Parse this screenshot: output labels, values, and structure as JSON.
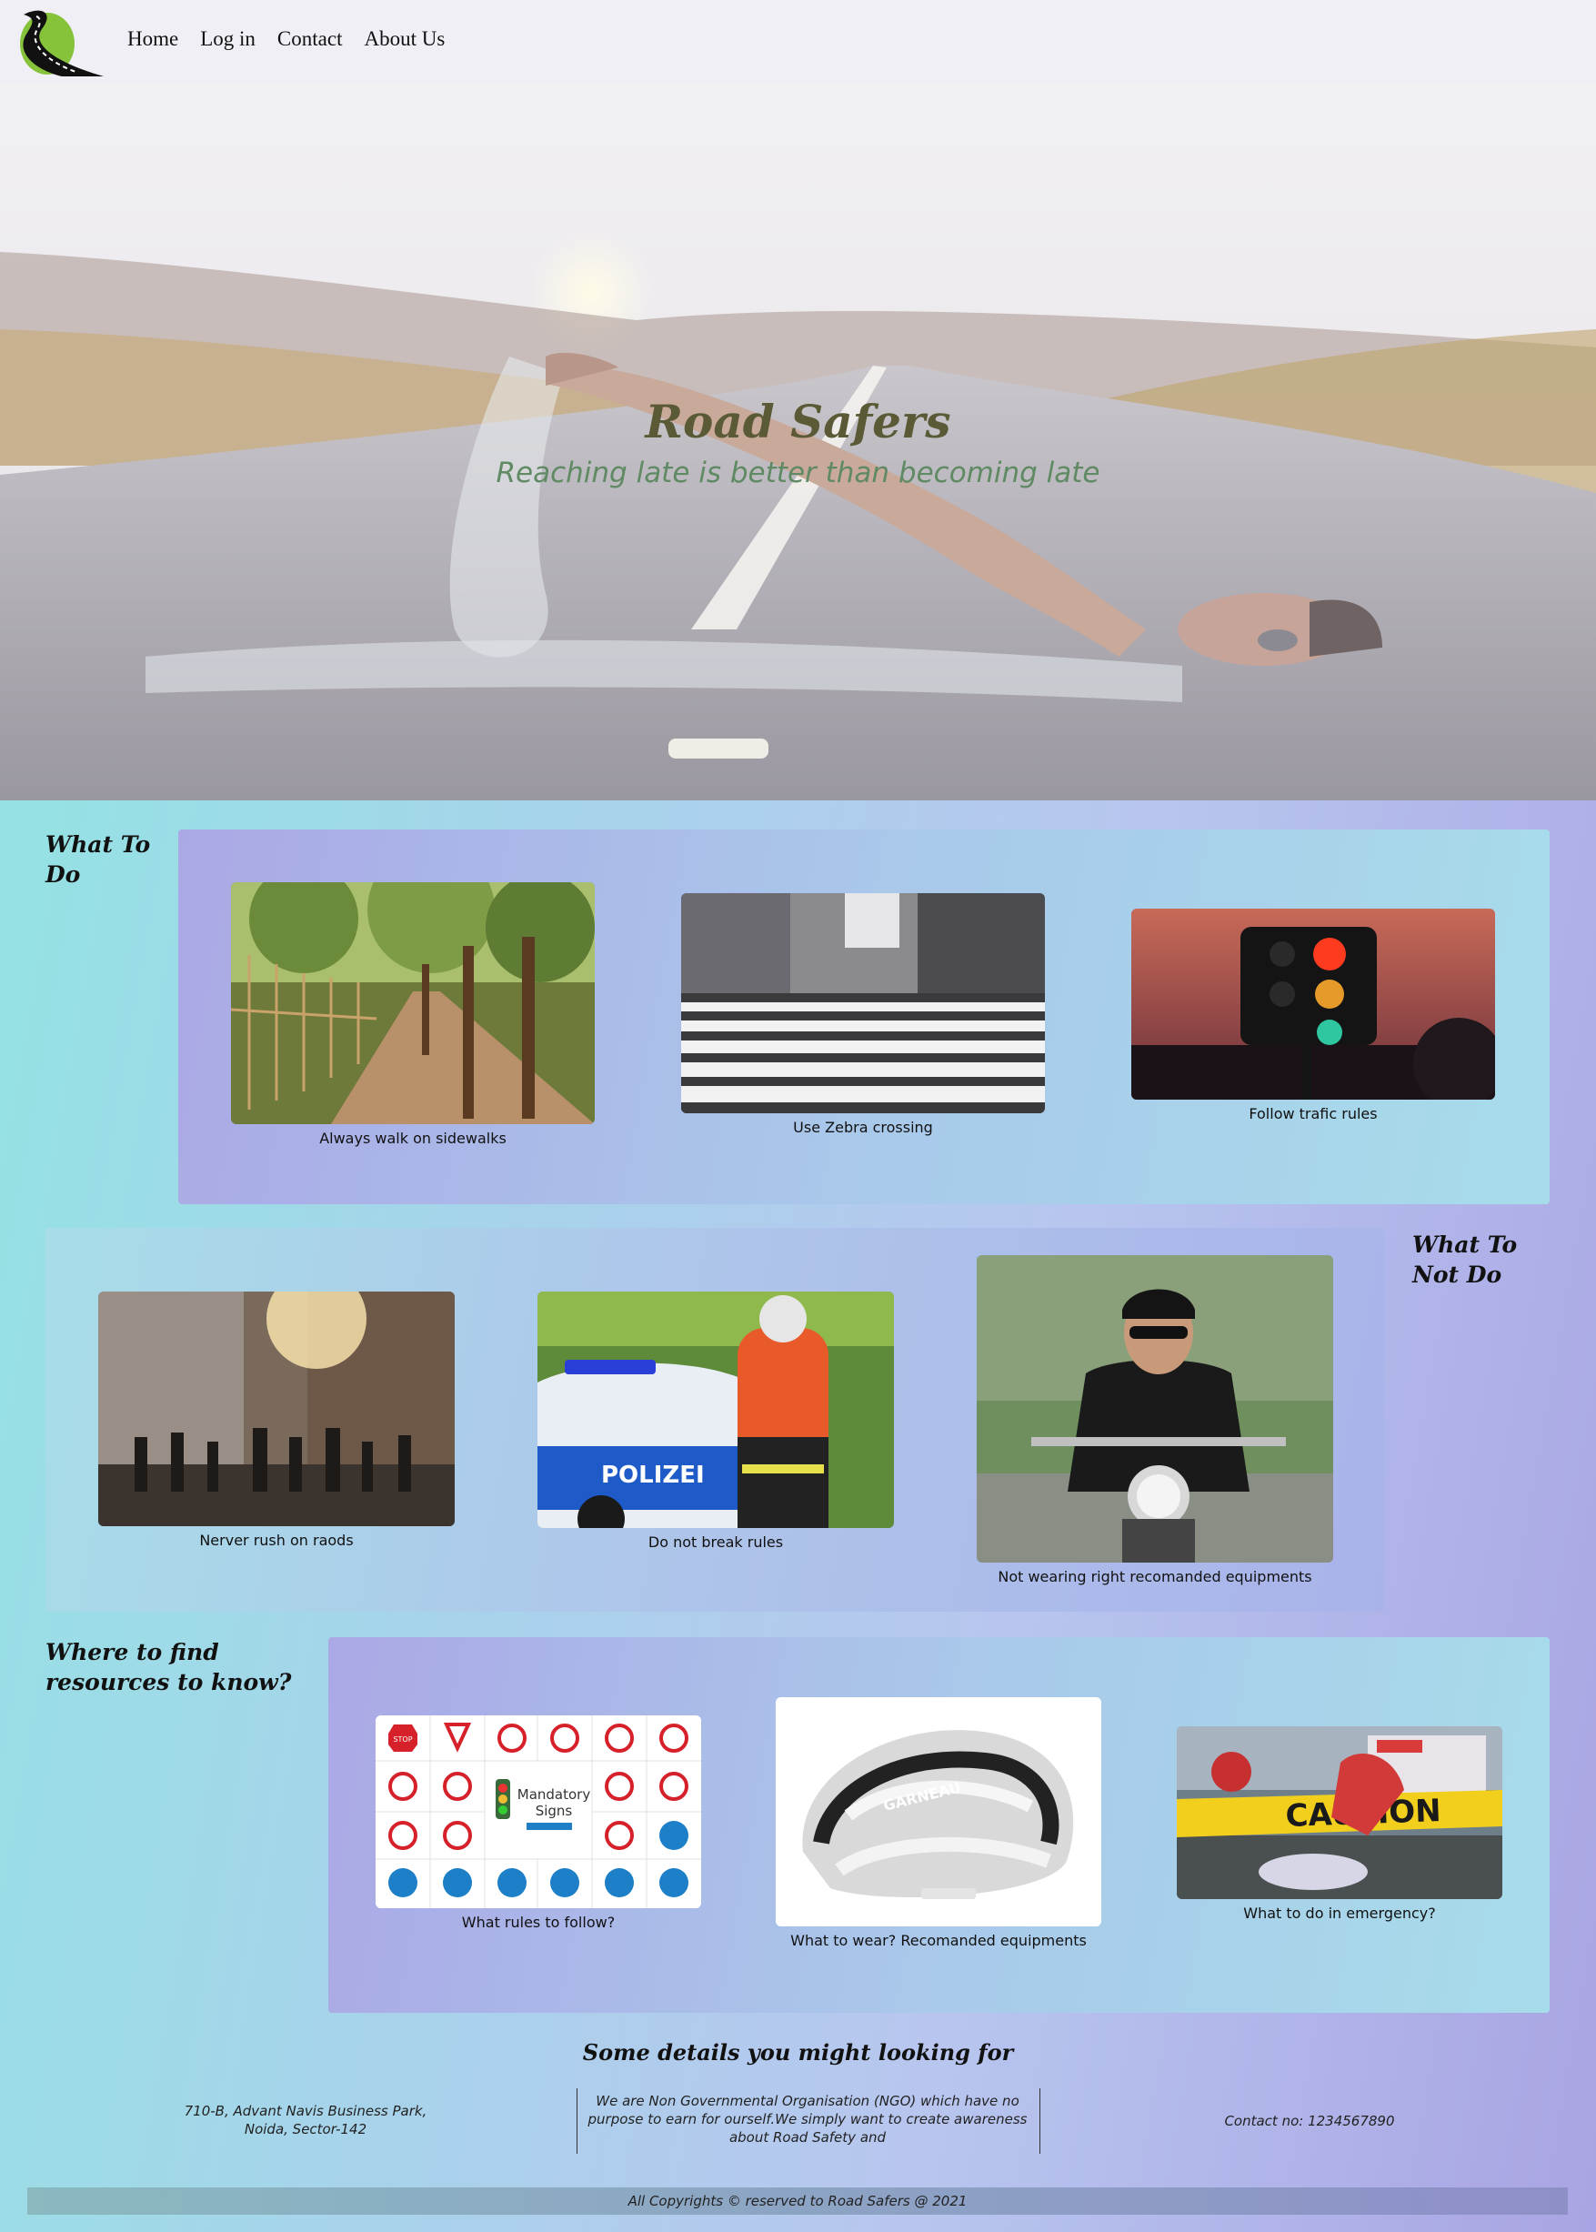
{
  "nav": {
    "links": [
      "Home",
      "Log in",
      "Contact",
      "About Us"
    ]
  },
  "hero": {
    "title": "Road Safers",
    "subtitle": "Reaching late is better than becoming late"
  },
  "what_to_do": {
    "title": "What To Do",
    "items": [
      {
        "caption": "Always walk on sidewalks",
        "icon": "sidewalk-photo"
      },
      {
        "caption": "Use Zebra crossing",
        "icon": "zebra-crossing-photo"
      },
      {
        "caption": "Follow trafic rules",
        "icon": "traffic-light-photo"
      }
    ]
  },
  "what_not_to_do": {
    "title": "What To Not Do",
    "items": [
      {
        "caption": "Nerver rush on raods",
        "icon": "crowd-street-photo"
      },
      {
        "caption": "Do not break rules",
        "icon": "police-car-photo"
      },
      {
        "caption": "Not wearing right recomanded equipments",
        "icon": "motorbike-rider-photo"
      }
    ]
  },
  "resources": {
    "title": "Where to find resources to know?",
    "items": [
      {
        "caption": "What rules to follow?",
        "icon": "mandatory-signs-chart",
        "sign_text": "Mandatory Signs"
      },
      {
        "caption": "What to wear? Recomanded equipments",
        "icon": "helmet-photo",
        "brand_text": "GARNEAU"
      },
      {
        "caption": "What to do in emergency?",
        "icon": "caution-tape-photo",
        "tape_text": "CAUTION"
      }
    ]
  },
  "footer": {
    "title": "Some details you might looking for",
    "address": "710-B, Advant Navis Business Park, Noida, Sector-142",
    "about": "We are Non Governmental Organisation (NGO) which have no purpose to earn for ourself.We simply want to create awareness about Road Safety and",
    "contact": "Contact no: 1234567890",
    "copyright": "All Copyrights © reserved to Road Safers @ 2021"
  },
  "colors": {
    "background_start": "#8fe6e2",
    "background_end": "#a9a4e3",
    "hero_title": "#5b5a37",
    "hero_subtitle": "#5f8a63"
  }
}
